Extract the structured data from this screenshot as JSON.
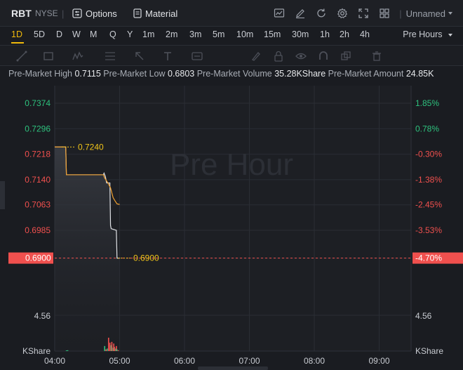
{
  "header": {
    "symbol": "RBT",
    "exchange": "NYSE",
    "options_label": "Options",
    "material_label": "Material",
    "layout_name": "Unnamed"
  },
  "intervals": [
    "1D",
    "5D",
    "D",
    "W",
    "M",
    "Q",
    "Y",
    "1m",
    "2m",
    "3m",
    "5m",
    "10m",
    "15m",
    "30m",
    "1h",
    "2h",
    "4h"
  ],
  "active_interval": "1D",
  "session_label": "Pre Hours",
  "info": {
    "high_label": "Pre-Market High",
    "high_value": "0.7115",
    "low_label": "Pre-Market Low",
    "low_value": "0.6803",
    "volume_label": "Pre-Market Volume",
    "volume_value": "35.28KShare",
    "amount_label": "Pre-Market Amount",
    "amount_value": "24.85K"
  },
  "colors": {
    "up": "#2ec27e",
    "down": "#f0504e",
    "price_line": "#e0e2e6",
    "avg_line": "#f0a030",
    "marker": "#f0c419",
    "accent": "#f0b90b"
  },
  "chart_data": {
    "type": "line",
    "watermark": "Pre Hour",
    "price_ticks": [
      "0.7374",
      "0.7296",
      "0.7218",
      "0.7140",
      "0.7063",
      "0.6985",
      "0.6900"
    ],
    "pct_ticks": [
      "1.85%",
      "0.78%",
      "-0.30%",
      "-1.38%",
      "-2.45%",
      "-3.53%",
      "-4.70%"
    ],
    "current_price": "0.6900",
    "current_pct": "-4.70%",
    "high_marker": "0.7240",
    "low_marker": "0.6900",
    "volume_tick": "4.56",
    "volume_unit": "KShare",
    "x_ticks": [
      "04:00",
      "05:00",
      "06:00",
      "07:00",
      "08:00",
      "09:00"
    ],
    "price_series": [
      [
        4.0,
        0.724
      ],
      [
        4.1,
        0.724
      ],
      [
        4.17,
        0.724
      ],
      [
        4.18,
        0.7155
      ],
      [
        4.5,
        0.7155
      ],
      [
        4.75,
        0.7155
      ],
      [
        4.76,
        0.716
      ],
      [
        4.78,
        0.715
      ],
      [
        4.8,
        0.713
      ],
      [
        4.85,
        0.713
      ],
      [
        4.86,
        0.7
      ],
      [
        4.87,
        0.699
      ],
      [
        4.95,
        0.6985
      ],
      [
        4.96,
        0.69
      ],
      [
        5.0,
        0.69
      ]
    ],
    "avg_series": [
      [
        4.0,
        0.724
      ],
      [
        4.17,
        0.724
      ],
      [
        4.18,
        0.7155
      ],
      [
        4.75,
        0.7155
      ],
      [
        4.77,
        0.7145
      ],
      [
        4.82,
        0.713
      ],
      [
        4.86,
        0.7115
      ],
      [
        4.9,
        0.7085
      ],
      [
        4.93,
        0.7075
      ],
      [
        4.96,
        0.7066
      ],
      [
        5.0,
        0.7064
      ]
    ],
    "volume_bars": [
      [
        4.18,
        0.08,
        "up"
      ],
      [
        4.2,
        0.1,
        "up"
      ],
      [
        4.77,
        0.6,
        "up"
      ],
      [
        4.79,
        0.2,
        "down"
      ],
      [
        4.81,
        0.3,
        "up"
      ],
      [
        4.83,
        1.6,
        "down"
      ],
      [
        4.85,
        1.0,
        "down"
      ],
      [
        4.87,
        0.7,
        "up"
      ],
      [
        4.88,
        1.1,
        "down"
      ],
      [
        4.9,
        0.4,
        "up"
      ],
      [
        4.91,
        0.9,
        "down"
      ],
      [
        4.92,
        0.5,
        "down"
      ],
      [
        4.94,
        0.3,
        "up"
      ],
      [
        4.95,
        0.6,
        "down"
      ],
      [
        4.96,
        0.2,
        "up"
      ],
      [
        4.98,
        0.1,
        "down"
      ]
    ],
    "volume_max": 6.9
  }
}
